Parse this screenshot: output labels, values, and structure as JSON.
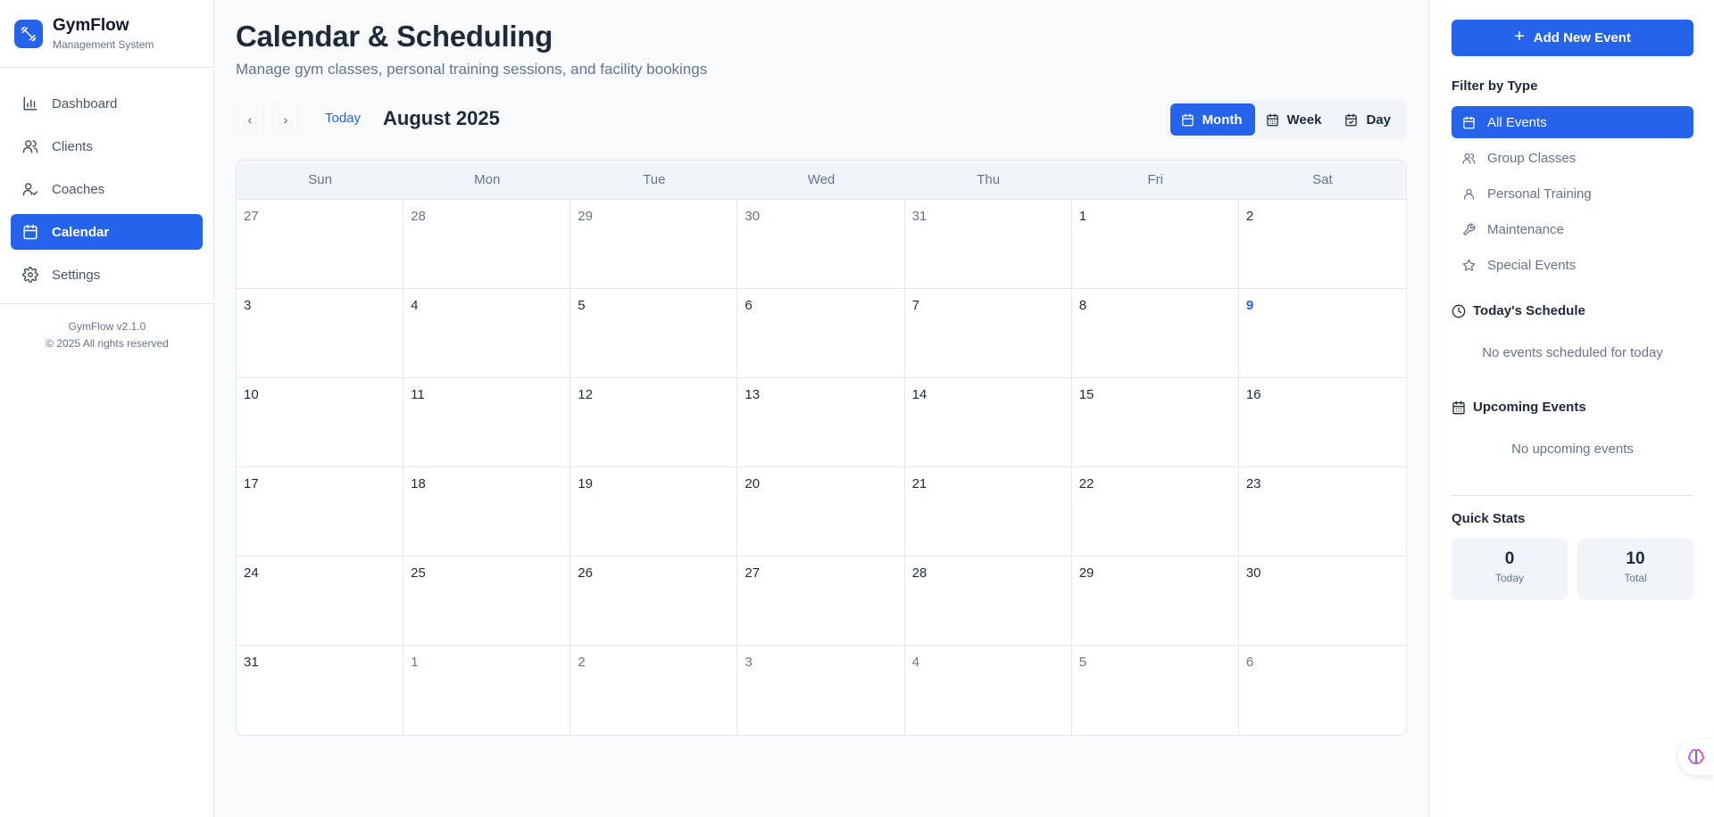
{
  "brand": {
    "name": "GymFlow",
    "subtitle": "Management System"
  },
  "nav": {
    "items": [
      {
        "label": "Dashboard",
        "icon": "chart-icon"
      },
      {
        "label": "Clients",
        "icon": "users-icon"
      },
      {
        "label": "Coaches",
        "icon": "user-check-icon"
      },
      {
        "label": "Calendar",
        "icon": "calendar-icon",
        "active": true
      },
      {
        "label": "Settings",
        "icon": "gear-icon"
      }
    ]
  },
  "footer": {
    "version": "GymFlow v2.1.0",
    "copyright": "© 2025 All rights reserved"
  },
  "page": {
    "title": "Calendar & Scheduling",
    "subtitle": "Manage gym classes, personal training sessions, and facility bookings"
  },
  "toolbar": {
    "prev": "‹",
    "next": "›",
    "today": "Today",
    "month_label": "August 2025",
    "views": {
      "month": "Month",
      "week": "Week",
      "day": "Day",
      "active": "Month"
    }
  },
  "calendar": {
    "weekdays": [
      "Sun",
      "Mon",
      "Tue",
      "Wed",
      "Thu",
      "Fri",
      "Sat"
    ],
    "days": [
      "27",
      "28",
      "29",
      "30",
      "31",
      "1",
      "2",
      "3",
      "4",
      "5",
      "6",
      "7",
      "8",
      "9",
      "10",
      "11",
      "12",
      "13",
      "14",
      "15",
      "16",
      "17",
      "18",
      "19",
      "20",
      "21",
      "22",
      "23",
      "24",
      "25",
      "26",
      "27",
      "28",
      "29",
      "30",
      "31",
      "1",
      "2",
      "3",
      "4",
      "5",
      "6"
    ],
    "other_month_indices": [
      0,
      1,
      2,
      3,
      4,
      36,
      37,
      38,
      39,
      40,
      41
    ],
    "today_index": 13
  },
  "right_panel": {
    "add_event": "Add New Event",
    "filter_title": "Filter by Type",
    "filters": {
      "all": "All Events",
      "group": "Group Classes",
      "personal": "Personal Training",
      "maintenance": "Maintenance",
      "special": "Special Events"
    },
    "today_title": "Today's Schedule",
    "today_empty": "No events scheduled for today",
    "upcoming_title": "Upcoming Events",
    "upcoming_empty": "No upcoming events",
    "stats_title": "Quick Stats",
    "stats": {
      "today_value": "0",
      "today_label": "Today",
      "total_value": "10",
      "total_label": "Total"
    }
  },
  "colors": {
    "accent": "#2563eb",
    "text": "#1e293b",
    "muted": "#64748b",
    "border": "#e2e8f0"
  }
}
